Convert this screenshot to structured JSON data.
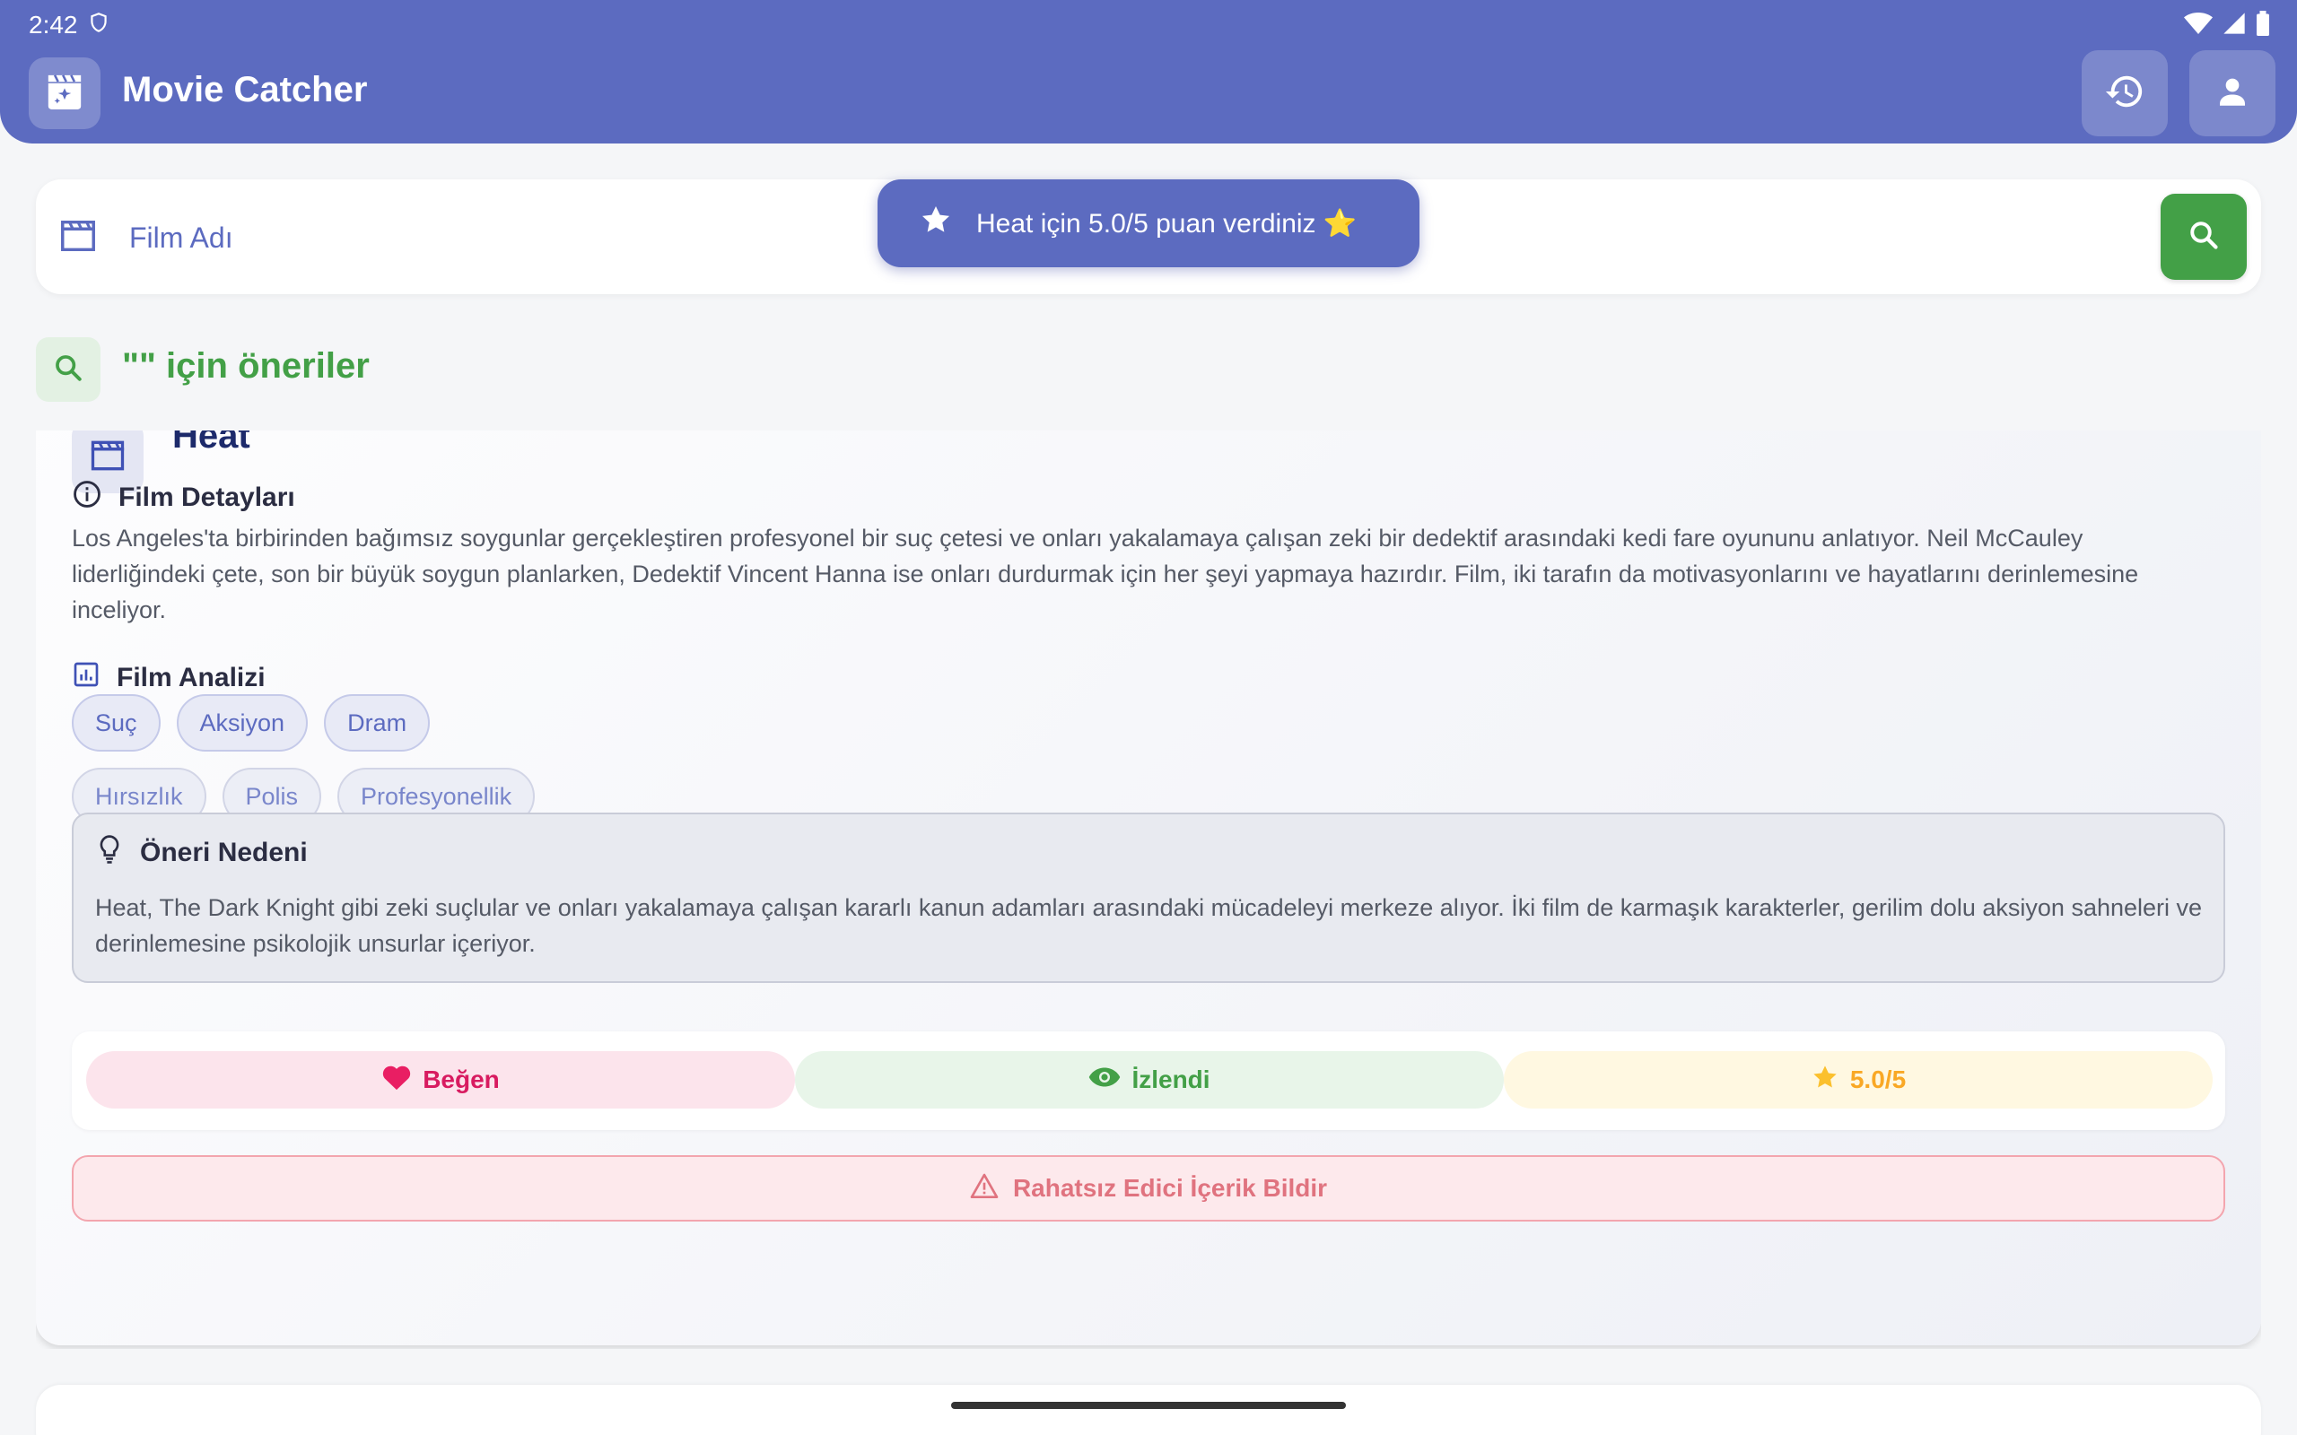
{
  "status": {
    "time": "2:42"
  },
  "app": {
    "title": "Movie Catcher"
  },
  "search": {
    "placeholder": "Film Adı"
  },
  "toast": {
    "text": "Heat için 5.0/5 puan verdiniz ⭐"
  },
  "suggestions": {
    "title": "\"\" için öneriler"
  },
  "movie": {
    "title": "Heat",
    "details_label": "Film Detayları",
    "description": "Los Angeles'ta birbirinden bağımsız soygunlar gerçekleştiren profesyonel bir suç çetesi ve onları yakalamaya çalışan zeki bir dedektif arasındaki kedi fare oyununu anlatıyor. Neil McCauley liderliğindeki çete, son bir büyük soygun planlarken, Dedektif Vincent Hanna ise onları durdurmak için her şeyi yapmaya hazırdır. Film, iki tarafın da motivasyonlarını ve hayatlarını derinlemesine inceliyor.",
    "analysis_label": "Film Analizi",
    "genres": [
      "Suç",
      "Aksiyon",
      "Dram"
    ],
    "tags": [
      "Hırsızlık",
      "Polis",
      "Profesyonellik"
    ],
    "reason_label": "Öneri Nedeni",
    "reason": "Heat, The Dark Knight gibi zeki suçlular ve onları yakalamaya çalışan kararlı kanun adamları arasındaki mücadeleyi merkeze alıyor. İki film de karmaşık karakterler, gerilim dolu aksiyon sahneleri ve derinlemesine psikolojik unsurlar içeriyor."
  },
  "actions": {
    "like_label": "Beğen",
    "watched_label": "İzlendi",
    "rating_label": "5.0/5",
    "report_label": "Rahatsız Edici İçerik Bildir"
  },
  "colors": {
    "primary": "#5c6bc0",
    "green": "#43a047",
    "like": "#e91e63",
    "star": "#fbc02d",
    "report": "#e0737f"
  }
}
